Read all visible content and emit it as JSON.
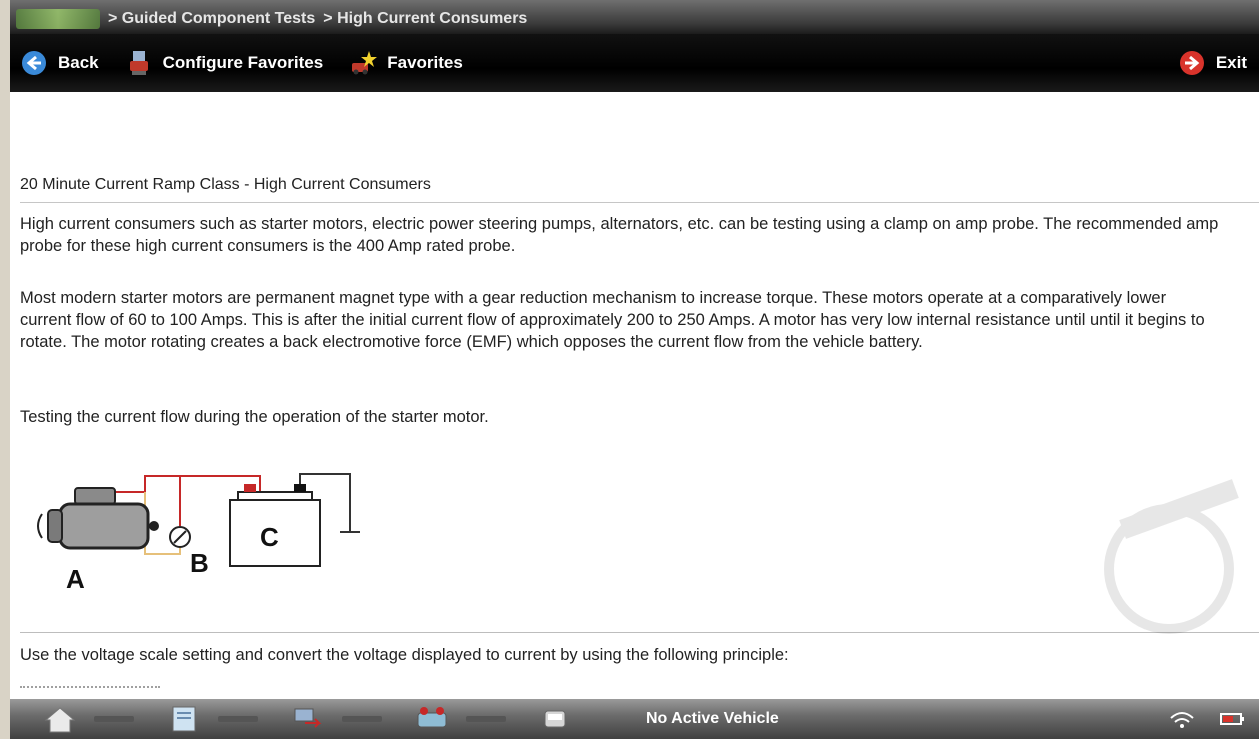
{
  "breadcrumb": {
    "items": [
      "> Guided Component Tests",
      "> High Current Consumers"
    ]
  },
  "toolbar": {
    "back_label": "Back",
    "configure_label": "Configure Favorites",
    "favorites_label": "Favorites",
    "exit_label": "Exit"
  },
  "content": {
    "heading": "20 Minute Current Ramp Class - High Current Consumers",
    "paragraph1": "High current consumers such as starter motors, electric power steering pumps, alternators, etc. can be testing using a clamp on amp probe. The recommended amp probe for these high current consumers is the 400 Amp rated probe.",
    "paragraph2": "Most modern starter motors are permanent magnet type with a gear reduction mechanism to increase torque. These motors operate at a comparatively lower current flow of 60 to 100 Amps. This is after the initial current flow of approximately 200 to 250 Amps. A motor has very low internal resistance until until it begins to rotate. The motor rotating creates a back electromotive force (EMF) which opposes the current flow from the vehicle battery.",
    "paragraph3": "Testing the current flow during the operation of the starter motor.",
    "paragraph4": "Use the voltage scale setting and convert the voltage displayed to current by using the following principle:"
  },
  "diagram": {
    "label_a": "A",
    "label_b": "B",
    "label_c": "C"
  },
  "statusbar": {
    "vehicle": "No Active Vehicle"
  },
  "colors": {
    "toolbar_bg": "#000000",
    "accent_red": "#d9332b",
    "back_blue": "#3a8ad9"
  }
}
